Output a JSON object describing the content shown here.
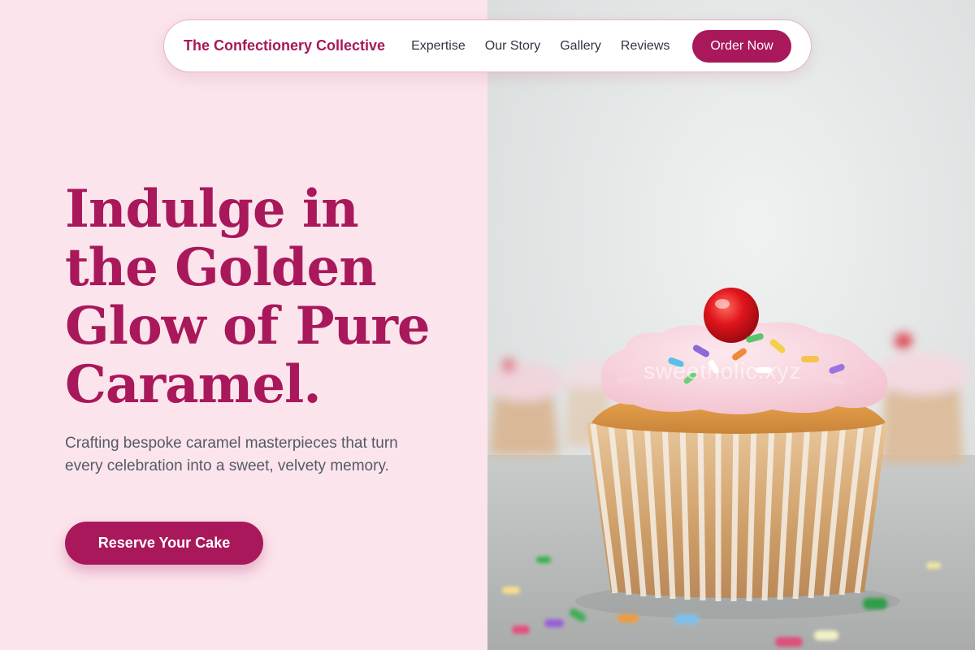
{
  "nav": {
    "brand": "The Confectionery Collective",
    "links": [
      "Expertise",
      "Our Story",
      "Gallery",
      "Reviews"
    ],
    "order_label": "Order Now"
  },
  "hero": {
    "title": "Indulge in the Golden Glow of Pure Caramel.",
    "subtitle": "Crafting bespoke caramel masterpieces that turn every celebration into a sweet, velvety memory.",
    "cta_label": "Reserve Your Cake"
  },
  "image": {
    "watermark": "sweetholic.xyz"
  },
  "colors": {
    "accent": "#a8185a",
    "left_background": "#fbe4ec",
    "body_text": "#555a66"
  }
}
